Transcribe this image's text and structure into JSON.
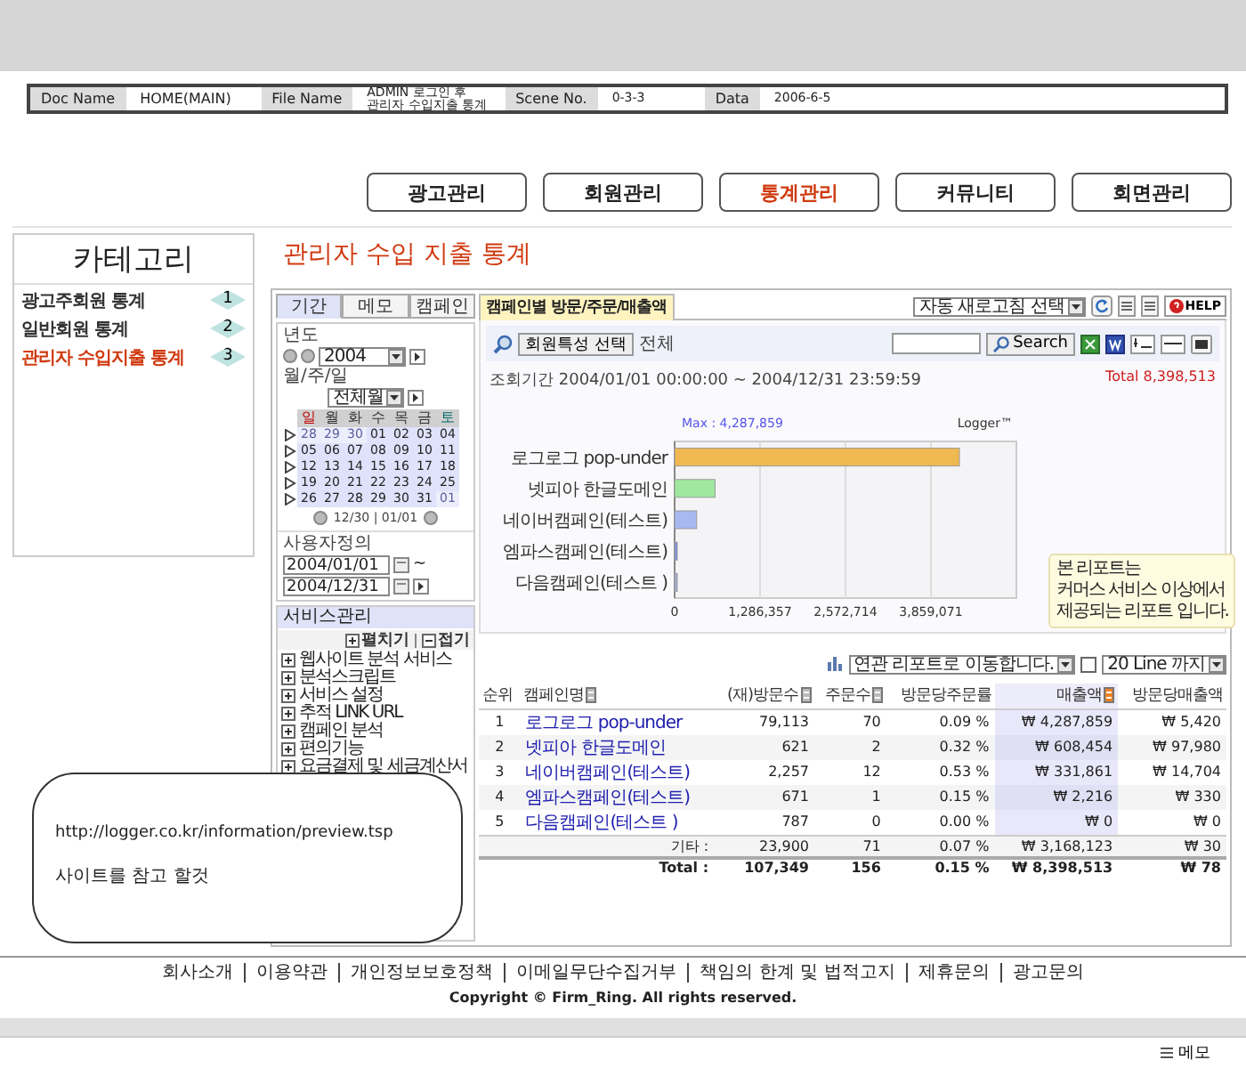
{
  "doc_info": [
    {
      "label": "Doc Name",
      "value": "HOME(MAIN)"
    },
    {
      "label": "File Name",
      "value": "ADMIN 로그인 후\n관리자 수입지출 통계"
    },
    {
      "label": "Scene No.",
      "value": "0-3-3"
    },
    {
      "label": "Data",
      "value": "2006-6-5"
    }
  ],
  "nav": [
    {
      "label": "광고관리",
      "selected": false
    },
    {
      "label": "회원관리",
      "selected": false
    },
    {
      "label": "통계관리",
      "selected": true
    },
    {
      "label": "커뮤니티",
      "selected": false
    },
    {
      "label": "회면관리",
      "selected": false
    }
  ],
  "sidebar": {
    "title": "카테고리",
    "items": [
      {
        "label": "광고주회원 통계",
        "number": "1",
        "selected": false
      },
      {
        "label": "일반회원 통계",
        "number": "2",
        "selected": false
      },
      {
        "label": "관리자 수입지출 통계",
        "number": "3",
        "selected": true
      }
    ]
  },
  "page_title": "관리자 수입 지출 통계",
  "app": {
    "left": {
      "tabs": [
        {
          "label": "기간",
          "selected": true
        },
        {
          "label": "메모",
          "selected": false
        },
        {
          "label": "캠페인",
          "selected": false
        }
      ],
      "year_label": "년도",
      "year": "2004",
      "period_label": "월/주/일",
      "period": "전체월",
      "calendar": {
        "weekdays": [
          "일",
          "월",
          "화",
          "수",
          "목",
          "금",
          "토"
        ],
        "weeks": [
          [
            {
              "day": "28",
              "muted": true
            },
            {
              "day": "29",
              "muted": true
            },
            {
              "day": "30",
              "muted": true
            },
            {
              "day": "01",
              "muted": false
            },
            {
              "day": "02",
              "muted": false
            },
            {
              "day": "03",
              "muted": false
            },
            {
              "day": "04",
              "muted": false
            }
          ],
          [
            {
              "day": "05",
              "muted": false
            },
            {
              "day": "06",
              "muted": false
            },
            {
              "day": "07",
              "muted": false
            },
            {
              "day": "08",
              "muted": false
            },
            {
              "day": "09",
              "muted": false
            },
            {
              "day": "10",
              "muted": false
            },
            {
              "day": "11",
              "muted": false
            }
          ],
          [
            {
              "day": "12",
              "muted": false
            },
            {
              "day": "13",
              "muted": false
            },
            {
              "day": "14",
              "muted": false
            },
            {
              "day": "15",
              "muted": false
            },
            {
              "day": "16",
              "muted": false
            },
            {
              "day": "17",
              "muted": false
            },
            {
              "day": "18",
              "muted": false
            }
          ],
          [
            {
              "day": "19",
              "muted": false
            },
            {
              "day": "20",
              "muted": false
            },
            {
              "day": "21",
              "muted": false
            },
            {
              "day": "22",
              "muted": false
            },
            {
              "day": "23",
              "muted": false
            },
            {
              "day": "24",
              "muted": false
            },
            {
              "day": "25",
              "muted": false
            }
          ],
          [
            {
              "day": "26",
              "muted": false
            },
            {
              "day": "27",
              "muted": false
            },
            {
              "day": "28",
              "muted": false
            },
            {
              "day": "29",
              "muted": false
            },
            {
              "day": "30",
              "muted": false
            },
            {
              "day": "31",
              "muted": false
            },
            {
              "day": "01",
              "muted": true
            }
          ]
        ],
        "nav_text": "12/30 | 01/01"
      },
      "custom_label": "사용자정의",
      "date_from": "2004/01/01",
      "range_sep": "~",
      "date_to": "2004/12/31",
      "service": {
        "title": "서비스관리",
        "expand": "펼치기",
        "collapse": "접기",
        "items": [
          "웹사이트 분석 서비스",
          "분석스크립트",
          "서비스 설정",
          "추적 LINK URL",
          "캠페인 분석",
          "편의기능",
          "요금결제 및 세금계산서"
        ]
      }
    },
    "right": {
      "tab": {
        "label": "캠페인별 방문/주문/매출액",
        "selected": true
      },
      "refresh_select": "자동 새로고침 선택",
      "help": "HELP",
      "filter_button": "회원특성 선택",
      "filter_value": "전체",
      "search_button": "Search",
      "period": "조회기간  2004/01/01 00:00:00 ~ 2004/12/31 23:59:59",
      "total": "Total 8,398,513",
      "chart_data": {
        "type": "bar",
        "orientation": "horizontal",
        "categories": [
          "로그로그 pop-under",
          "넷피아 한글도메인",
          "네이버캠페인(테스트)",
          "엠파스캠페인(테스트)",
          "다음캠페인(테스트 )"
        ],
        "values": [
          4287859,
          608454,
          331861,
          2216,
          0
        ],
        "xlim": [
          0,
          5145428
        ],
        "xticks": [
          0,
          {
            "value": 1286357,
            "label": "1,286,357"
          },
          {
            "value": 2572714,
            "label": "2,572,714"
          },
          {
            "value": 3859071,
            "label": "3,859,071"
          }
        ],
        "grid": true,
        "annotations": [
          "Max : 4,287,859"
        ]
      },
      "chart_logo": "Logger™",
      "note": "본 리포트는\n커머스 서비스 이상에서\n제공되는 리포트 입니다.",
      "related_select": "연관 리포트로 이동합니다.",
      "line_checked": false,
      "line_select": "20 Line 까지",
      "table": {
        "columns": [
          {
            "label": "순위",
            "sortable": false,
            "sorted": false
          },
          {
            "label": "캠페인명",
            "sortable": true,
            "sorted": false
          },
          {
            "label": "(재)방문수",
            "sortable": true,
            "sorted": false
          },
          {
            "label": "주문수",
            "sortable": true,
            "sorted": false
          },
          {
            "label": "방문당주문률",
            "sortable": false,
            "sorted": false
          },
          {
            "label": "매출액",
            "sortable": true,
            "sorted": true
          },
          {
            "label": "방문당매출액",
            "sortable": false,
            "sorted": false
          }
        ],
        "rows": [
          {
            "kind": "item",
            "cells": [
              "1",
              "로그로그 pop-under",
              "79,113",
              "70",
              "0.09 %",
              "₩ 4,287,859",
              "₩ 5,420"
            ]
          },
          {
            "kind": "item",
            "cells": [
              "2",
              "넷피아 한글도메인",
              "621",
              "2",
              "0.32 %",
              "₩ 608,454",
              "₩ 97,980"
            ]
          },
          {
            "kind": "item",
            "cells": [
              "3",
              "네이버캠페인(테스트)",
              "2,257",
              "12",
              "0.53 %",
              "₩ 331,861",
              "₩ 14,704"
            ]
          },
          {
            "kind": "item",
            "cells": [
              "4",
              "엠파스캠페인(테스트)",
              "671",
              "1",
              "0.15 %",
              "₩ 2,216",
              "₩ 330"
            ]
          },
          {
            "kind": "item",
            "cells": [
              "5",
              "다음캠페인(테스트 )",
              "787",
              "0",
              "0.00 %",
              "₩ 0",
              "₩ 0"
            ]
          },
          {
            "kind": "other",
            "label": "기타 :",
            "cells": [
              "23,900",
              "71",
              "0.07 %",
              "₩ 3,168,123",
              "₩ 30"
            ]
          },
          {
            "kind": "total",
            "label": "Total :",
            "cells": [
              "107,349",
              "156",
              "0.15 %",
              "₩ 8,398,513",
              "₩ 78"
            ]
          }
        ]
      }
    }
  },
  "memo": {
    "url": "http://logger.co.kr/information/preview.tsp",
    "note": "사이트를 참고 할것"
  },
  "footer": {
    "links": [
      "회사소개",
      "이용약관",
      "개인정보보호정책",
      "이메일무단수집거부",
      "책임의 한계 및 법적고지",
      "제휴문의",
      "광고문의"
    ],
    "copyright": "Copyright © Firm_Ring.  All rights reserved."
  },
  "status_bar": {
    "memo": "메모"
  }
}
